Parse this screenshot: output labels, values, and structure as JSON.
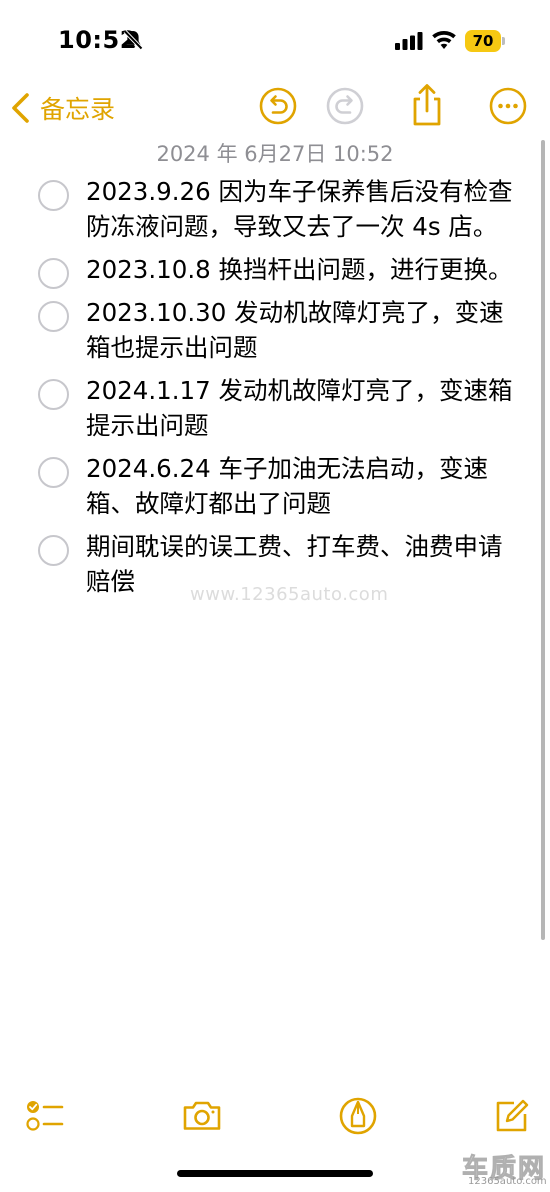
{
  "status_bar": {
    "time": "10:52",
    "battery_level": "70",
    "icons": [
      "bell-slash-icon",
      "cellular-signal-icon",
      "wifi-icon",
      "battery-icon"
    ]
  },
  "nav": {
    "back_label": "备忘录",
    "icons": [
      "chevron-left-icon",
      "undo-icon",
      "redo-icon",
      "share-icon",
      "more-icon"
    ]
  },
  "note": {
    "date": "2024 年 6月27日 10:52",
    "checklist": [
      {
        "text": "2023.9.26 因为车子保养售后没有检查防冻液问题，导致又去了一次 4s 店。",
        "checked": false
      },
      {
        "text": "2023.10.8 换挡杆出问题，进行更换。",
        "checked": false
      },
      {
        "text": "2023.10.30 发动机故障灯亮了，变速箱也提示出问题",
        "checked": false
      },
      {
        "text": "2024.1.17 发动机故障灯亮了，变速箱提示出问题",
        "checked": false
      },
      {
        "text": "2024.6.24 车子加油无法启动，变速箱、故障灯都出了问题",
        "checked": false
      },
      {
        "text": "期间耽误的误工费、打车费、油费申请赔偿",
        "checked": false
      }
    ]
  },
  "watermark": "www.12365auto.com",
  "toolbar": {
    "icons": [
      "checklist-icon",
      "camera-icon",
      "markup-icon",
      "compose-icon"
    ]
  },
  "logo": {
    "name": "车质网",
    "url": "12365auto.com"
  },
  "colors": {
    "accent": "#e0a400",
    "battery": "#f6c812",
    "date_text": "#8e8e93",
    "circle_border": "#c7c7cc"
  }
}
